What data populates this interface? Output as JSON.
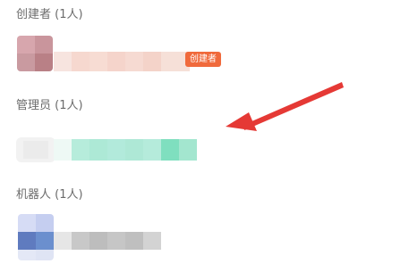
{
  "sections": {
    "creator": {
      "title": "创建者 (1人)",
      "badge": "创建者"
    },
    "admin": {
      "title": "管理员 (1人)"
    },
    "robot": {
      "title": "机器人 (1人)"
    }
  },
  "colors": {
    "section_title": "#6b6b6b",
    "badge_bg": "#f06a3c",
    "arrow": "#e53935"
  },
  "icons": {
    "annotation_arrow": "arrow-icon"
  }
}
